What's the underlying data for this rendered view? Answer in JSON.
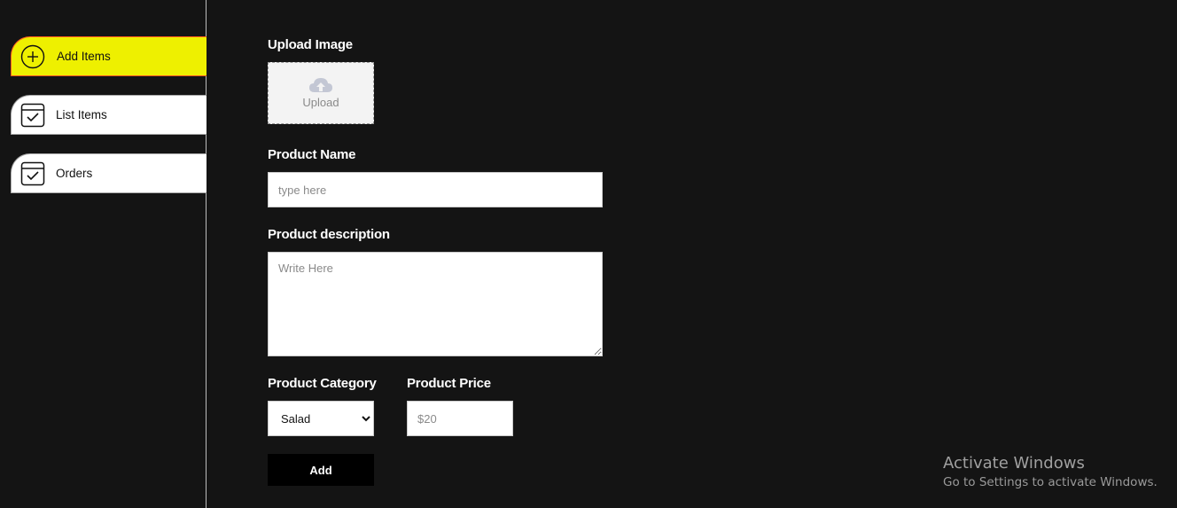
{
  "sidebar": {
    "items": [
      {
        "label": "Add Items",
        "icon": "add-circle-icon",
        "active": true
      },
      {
        "label": "List Items",
        "icon": "calendar-check-icon",
        "active": false
      },
      {
        "label": "Orders",
        "icon": "calendar-check-icon",
        "active": false
      }
    ]
  },
  "form": {
    "upload_label": "Upload Image",
    "upload_text": "Upload",
    "name_label": "Product Name",
    "name_placeholder": "type here",
    "description_label": "Product description",
    "description_placeholder": "Write Here",
    "category_label": "Product Category",
    "category_selected": "Salad",
    "price_label": "Product Price",
    "price_placeholder": "$20",
    "submit_label": "Add"
  },
  "watermark": {
    "title": "Activate Windows",
    "subtitle": "Go to Settings to activate Windows."
  },
  "colors": {
    "background": "#141414",
    "active_nav": "#eef000",
    "active_nav_border": "#ff5a1f",
    "button": "#000000"
  }
}
